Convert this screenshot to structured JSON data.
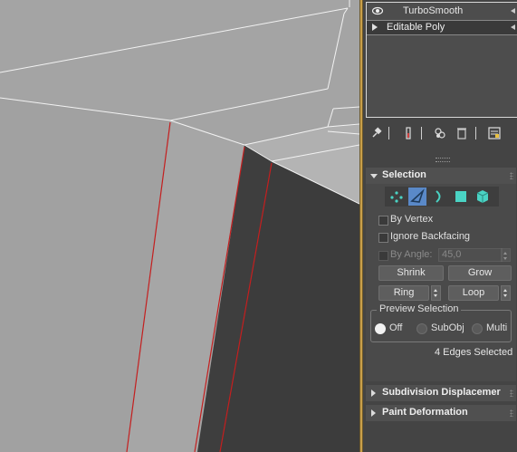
{
  "modifier_stack": {
    "items": [
      {
        "label": "TurboSmooth",
        "icon": "eye-icon"
      },
      {
        "label": "Editable Poly",
        "icon": "expand-triangle-icon",
        "selected": true
      }
    ]
  },
  "toolbar": {
    "icons": [
      "pin-stack-icon",
      "show-end-result-icon",
      "make-unique-icon",
      "remove-modifier-icon",
      "configure-modifier-sets-icon"
    ]
  },
  "selection": {
    "title": "Selection",
    "modes": [
      "vertex-mode-icon",
      "edge-mode-icon",
      "border-mode-icon",
      "polygon-mode-icon",
      "element-mode-icon"
    ],
    "active_mode": "edge-mode-icon",
    "by_vertex": "By Vertex",
    "ignore_backfacing": "Ignore Backfacing",
    "by_angle": "By Angle:",
    "angle_value": "45,0",
    "shrink": "Shrink",
    "grow": "Grow",
    "ring": "Ring",
    "loop": "Loop",
    "preview": {
      "title": "Preview Selection",
      "off": "Off",
      "subobj": "SubObj",
      "multi": "Multi",
      "selected": "Off"
    },
    "status": "4 Edges Selected"
  },
  "rollouts": {
    "subdivision": "Subdivision Displacemer",
    "paint": "Paint Deformation"
  },
  "colors": {
    "viewport_bg": "#a4a4a4",
    "selected_edge": "#c41f1f",
    "active_mode": "#5a89c8",
    "divider": "#caa04a"
  }
}
